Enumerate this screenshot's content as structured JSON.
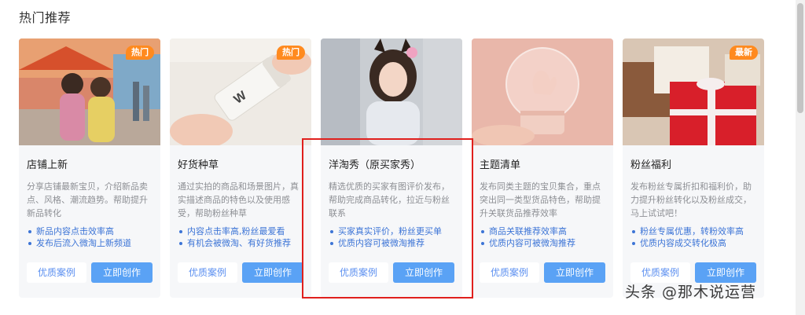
{
  "section_title": "热门推荐",
  "cards": [
    {
      "title": "店铺上新",
      "badge": "热门",
      "desc": "分享店铺最新宝贝，介绍新品卖点、风格、潮流趋势。帮助提升新品转化",
      "features": [
        "新品内容点击效率高",
        "发布后流入微淘上新频道"
      ],
      "case_label": "优质案例",
      "create_label": "立即创作"
    },
    {
      "title": "好货种草",
      "badge": "热门",
      "desc": "通过实拍的商品和场景图片，真实描述商品的特色以及使用感受，帮助粉丝种草",
      "features": [
        "内容点击率高,粉丝最爱看",
        "有机会被微淘、有好货推荐"
      ],
      "case_label": "优质案例",
      "create_label": "立即创作"
    },
    {
      "title": "洋淘秀（原买家秀）",
      "badge": "",
      "desc": "精选优质的买家有图评价发布，帮助完成商品转化，拉近与粉丝联系",
      "features": [
        "买家真实评价，粉丝更买单",
        "优质内容可被微淘推荐"
      ],
      "case_label": "优质案例",
      "create_label": "立即创作"
    },
    {
      "title": "主题清单",
      "badge": "",
      "desc": "发布同类主题的宝贝集合，重点突出同一类型货品特色，帮助提升关联货品推荐效率",
      "features": [
        "商品关联推荐效率高",
        "优质内容可被微淘推荐"
      ],
      "case_label": "优质案例",
      "create_label": "立即创作"
    },
    {
      "title": "粉丝福利",
      "badge": "最新",
      "desc": "发布粉丝专属折扣和福利价，助力提升粉丝转化以及粉丝成交，马上试试吧！",
      "features": [
        "粉丝专属优惠，转粉效率高",
        "优质内容成交转化极高"
      ],
      "case_label": "优质案例",
      "create_label": "立即创作"
    }
  ],
  "watermark": "头条 @那木说运营",
  "colors": {
    "badge": "#ff8a1f",
    "create_button": "#5aa2f5",
    "feature_text": "#3c74d6",
    "highlight_border": "#e0201d"
  }
}
